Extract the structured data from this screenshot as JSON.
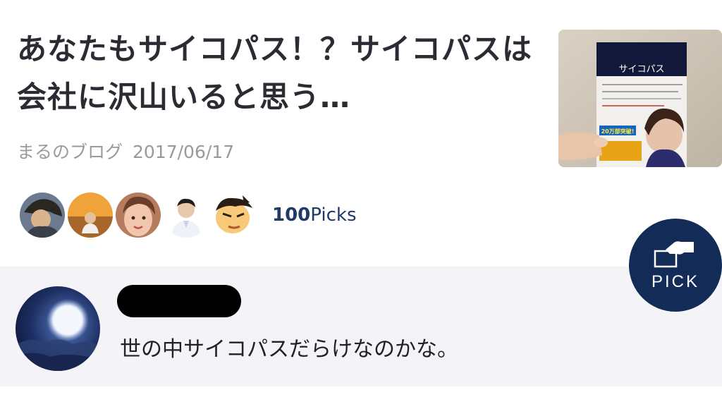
{
  "article": {
    "title": "あなたもサイコパス！？サイコパスは会社に沢山いると思う…",
    "source": "まるのブログ",
    "date": "2017/06/17",
    "thumbnail": {
      "book_title": "サイコパス",
      "badge": "20万部突破!"
    }
  },
  "pickers": {
    "avatars": [
      "picker-avatar-1",
      "picker-avatar-2",
      "picker-avatar-3",
      "picker-avatar-4",
      "picker-avatar-5"
    ],
    "count": "100",
    "count_suffix": "Picks"
  },
  "comment": {
    "text": "世の中サイコパスだらけなのかな。"
  },
  "pick_button": {
    "label": "PICK",
    "background": "#132b57"
  },
  "colors": {
    "title": "#2b2b33",
    "meta": "#9a9a9a",
    "picks": "#1f3a68",
    "comment_bg": "#f4f4f8"
  }
}
